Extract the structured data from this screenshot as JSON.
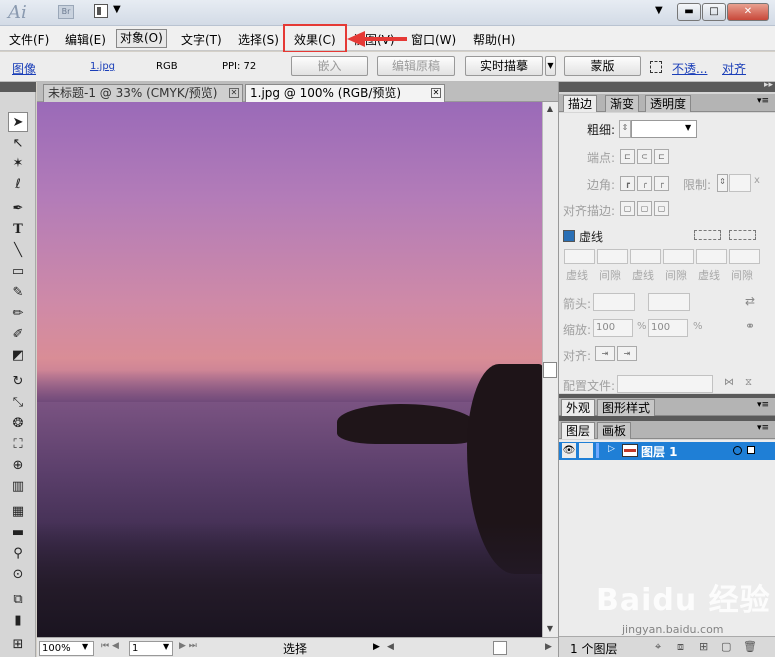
{
  "titlebar": {
    "logo": "Ai",
    "bridge": "Br",
    "win_min": "▬",
    "win_max": "□",
    "win_close": "✕"
  },
  "menus": [
    "文件(F)",
    "编辑(E)",
    "对象(O)",
    "文字(T)",
    "选择(S)",
    "效果(C)",
    "视图(V)",
    "窗口(W)",
    "帮助(H)"
  ],
  "control": {
    "type_label": "图像",
    "file_link": "1.jpg",
    "color_mode": "RGB",
    "ppi_label": "PPI: 72",
    "embed_btn": "嵌入",
    "edit_orig_btn": "编辑原稿",
    "live_trace_btn": "实时描摹",
    "mask_btn": "蒙版",
    "opacity_link": "不透...",
    "align_link": "对齐"
  },
  "tabs": {
    "doc1": "未标题-1 @ 33% (CMYK/预览)",
    "doc2": "1.jpg @ 100% (RGB/预览)"
  },
  "status": {
    "zoom": "100%",
    "page": "1",
    "tool": "选择"
  },
  "stroke_panel": {
    "tabs": [
      "描边",
      "渐变",
      "透明度"
    ],
    "weight_label": "粗细:",
    "cap_label": "端点:",
    "corner_label": "边角:",
    "limit_label": "限制:",
    "limit_suffix": "x",
    "align_label": "对齐描边:",
    "dashed_label": "虚线",
    "dash_labels": [
      "虚线",
      "间隙",
      "虚线",
      "间隙",
      "虚线",
      "间隙"
    ],
    "arrow_label": "箭头:",
    "scale_label": "缩放:",
    "scale1": "100",
    "scale2": "100",
    "percent": "%",
    "align2_label": "对齐:",
    "profile_label": "配置文件:"
  },
  "appearance_panel": {
    "tabs": [
      "外观",
      "图形样式"
    ]
  },
  "layers_panel": {
    "tabs": [
      "图层",
      "画板"
    ],
    "layer_name": "图层 1",
    "count": "1 个图层"
  },
  "watermark": {
    "brand": "Baidu 经验",
    "url": "jingyan.baidu.com"
  }
}
